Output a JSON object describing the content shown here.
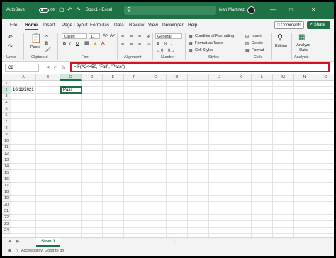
{
  "titlebar": {
    "autosave_label": "AutoSave",
    "toggle_state": "Off",
    "filename": "Book1 - Excel",
    "user_name": "Ivan Martinez",
    "icons": [
      "save-icon",
      "undo-icon",
      "redo-icon",
      "search-icon",
      "minimize-icon",
      "maximize-icon",
      "close-icon"
    ]
  },
  "tabs": [
    "File",
    "Home",
    "Insert",
    "Page Layout",
    "Formulas",
    "Data",
    "Review",
    "View",
    "Developer",
    "Help"
  ],
  "active_tab": "Home",
  "actions": {
    "comments": "Comments",
    "share": "Share"
  },
  "ribbon": {
    "undo_label": "Undo",
    "paste_label": "Paste",
    "clipboard_label": "Clipboard",
    "font_name": "Calibri",
    "font_size": "11",
    "font_label": "Font",
    "bold": "B",
    "italic": "I",
    "underline": "U",
    "alignment_label": "Alignment",
    "number_format": "General",
    "number_label": "Number",
    "currency_symbol": "$",
    "percent_symbol": "%",
    "conditional_formatting": "Conditional Formatting",
    "format_as_table": "Format as Table",
    "cell_styles": "Cell Styles",
    "styles_label": "Styles",
    "insert": "Insert",
    "delete": "Delete",
    "format": "Format",
    "cells_label": "Cells",
    "editing": "Editing",
    "analyze_data": "Analyze Data",
    "analysis_label": "Analysis"
  },
  "formula_bar": {
    "name_box": "C2",
    "formula": "=IF(A2<=50, \"Fail\", \"Pass\")",
    "fx_label": "fx"
  },
  "grid": {
    "columns": [
      "A",
      "B",
      "C",
      "D",
      "E",
      "F",
      "G",
      "H",
      "I",
      "J",
      "K",
      "L",
      "M",
      "N",
      "O"
    ],
    "rows": [
      "1",
      "2",
      "3",
      "4",
      "5",
      "6",
      "7",
      "8",
      "9",
      "10",
      "11",
      "12",
      "13",
      "14",
      "15",
      "16",
      "17",
      "18",
      "19",
      "20",
      "21",
      "22",
      "23",
      "24"
    ],
    "cells": {
      "A2": "10/11/2021",
      "C2": "Pass"
    },
    "selected_cell": "C2"
  },
  "sheets": {
    "tabs": [
      "Sheet1"
    ],
    "active": "Sheet1",
    "add_symbol": "+"
  },
  "status": {
    "accessibility": "Accessibility: Good to go"
  },
  "colors": {
    "brand": "#1e7145",
    "highlight": "#d4141e"
  }
}
